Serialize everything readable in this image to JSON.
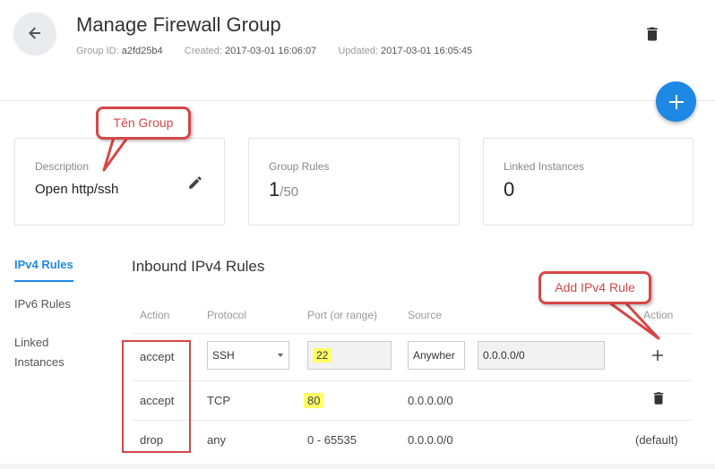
{
  "header": {
    "title": "Manage Firewall Group",
    "group_id_label": "Group ID:",
    "group_id": "a2fd25b4",
    "created_label": "Created:",
    "created": "2017-03-01 16:06:07",
    "updated_label": "Updated:",
    "updated": "2017-03-01 16:05:45"
  },
  "cards": {
    "description": {
      "label": "Description",
      "value": "Open http/ssh"
    },
    "group_rules": {
      "label": "Group Rules",
      "value": "1",
      "max": "/50"
    },
    "linked_instances": {
      "label": "Linked Instances",
      "value": "0"
    }
  },
  "sidebar": {
    "items": [
      {
        "label": "IPv4 Rules",
        "active": true
      },
      {
        "label": "IPv6 Rules",
        "active": false
      },
      {
        "label": "Linked",
        "active": false
      },
      {
        "label": "Instances",
        "active": false
      }
    ]
  },
  "section": {
    "title": "Inbound IPv4 Rules"
  },
  "table": {
    "headers": [
      "Action",
      "Protocol",
      "Port (or range)",
      "Source",
      "Action"
    ],
    "new_row": {
      "action": "accept",
      "protocol": "SSH",
      "port": "22",
      "source": "Anywhere",
      "source_display": "Anywher",
      "cidr": "0.0.0.0/0"
    },
    "rows": [
      {
        "action": "accept",
        "protocol": "TCP",
        "port": "80",
        "source": "0.0.0.0/0",
        "extra": ""
      },
      {
        "action": "drop",
        "protocol": "any",
        "port": "0 - 65535",
        "source": "0.0.0.0/0",
        "extra": "(default)"
      }
    ]
  },
  "annotations": {
    "group_name": "Tên Group",
    "add_rule": "Add IPv4 Rule"
  },
  "colors": {
    "accent": "#1e88e5",
    "annotation": "#d64747",
    "highlight": "#ffff66"
  },
  "icons": [
    "arrow-left-icon",
    "trash-icon",
    "plus-icon",
    "pencil-icon",
    "chevron-down-icon"
  ]
}
